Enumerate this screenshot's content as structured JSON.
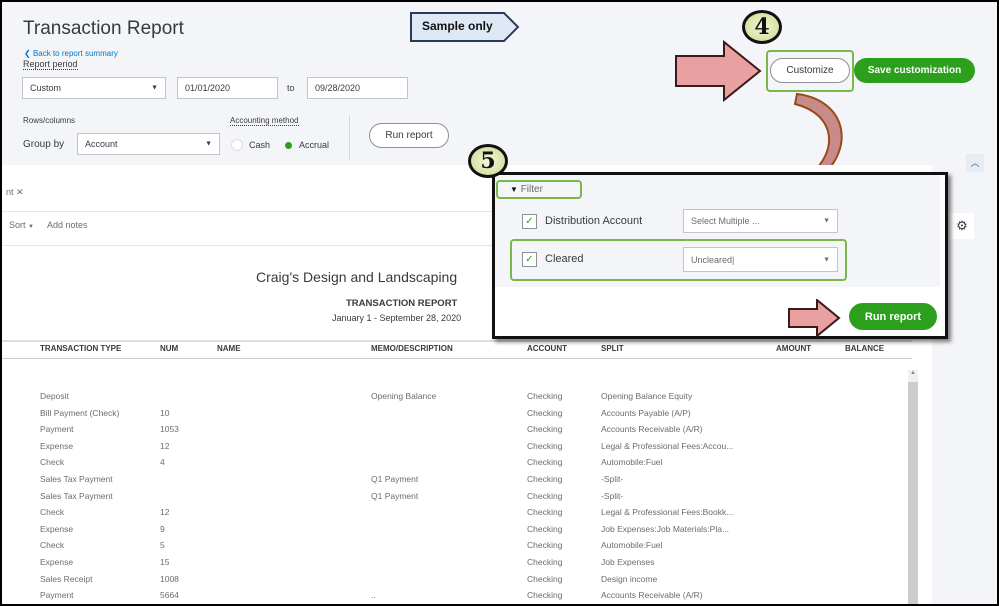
{
  "header": {
    "title": "Transaction Report",
    "back_link": "Back to report summary",
    "sample_label": "Sample only"
  },
  "controls": {
    "report_period_label": "Report period",
    "period_value": "Custom",
    "from_date": "01/01/2020",
    "to_label": "to",
    "to_date": "09/28/2020",
    "rows_columns_label": "Rows/columns",
    "group_by_label": "Group by",
    "group_by_value": "Account",
    "accounting_method_label": "Accounting method",
    "cash_label": "Cash",
    "accrual_label": "Accrual",
    "run_report_label": "Run report"
  },
  "actions": {
    "customize_label": "Customize",
    "save_customization_label": "Save customization"
  },
  "annotations": {
    "step4": "4",
    "step5": "5"
  },
  "toolbar": {
    "filter_chip": "nt",
    "sort_label": "Sort",
    "add_notes_label": "Add notes"
  },
  "report": {
    "company": "Craig's Design and Landscaping",
    "name": "TRANSACTION REPORT",
    "period": "January 1 - September 28, 2020",
    "columns": [
      "TRANSACTION TYPE",
      "NUM",
      "NAME",
      "MEMO/DESCRIPTION",
      "ACCOUNT",
      "SPLIT",
      "AMOUNT",
      "BALANCE"
    ],
    "rows": [
      [
        "Deposit",
        "",
        "",
        "Opening Balance",
        "Checking",
        "Opening Balance Equity"
      ],
      [
        "Bill Payment (Check)",
        "10",
        "",
        "",
        "Checking",
        "Accounts Payable (A/P)"
      ],
      [
        "Payment",
        "1053",
        "",
        "",
        "Checking",
        "Accounts Receivable (A/R)"
      ],
      [
        "Expense",
        "12",
        "",
        "",
        "Checking",
        "Legal & Professional Fees:Accou..."
      ],
      [
        "Check",
        "4",
        "",
        "",
        "Checking",
        "Automobile:Fuel"
      ],
      [
        "Sales Tax Payment",
        "",
        "",
        "Q1 Payment",
        "Checking",
        "-Split-"
      ],
      [
        "Sales Tax Payment",
        "",
        "",
        "Q1 Payment",
        "Checking",
        "-Split-"
      ],
      [
        "Check",
        "12",
        "",
        "",
        "Checking",
        "Legal & Professional Fees:Bookk..."
      ],
      [
        "Expense",
        "9",
        "",
        "",
        "Checking",
        "Job Expenses:Job Materials:Pla..."
      ],
      [
        "Check",
        "5",
        "",
        "",
        "Checking",
        "Automobile:Fuel"
      ],
      [
        "Expense",
        "15",
        "",
        "",
        "Checking",
        "Job Expenses"
      ],
      [
        "Sales Receipt",
        "1008",
        "",
        "",
        "Checking",
        "Design income"
      ],
      [
        "Payment",
        "5664",
        "",
        "..",
        "Checking",
        "Accounts Receivable (A/R)"
      ]
    ]
  },
  "filter_panel": {
    "title": "Filter",
    "distribution_label": "Distribution Account",
    "distribution_value": "Select Multiple ...",
    "cleared_label": "Cleared",
    "cleared_value": "Uncleared",
    "run_report_label": "Run report"
  },
  "colors": {
    "accent": "#2ca01c",
    "link": "#0077c5",
    "highlight": "#7ab648",
    "arrow": "#e8a0a0"
  }
}
